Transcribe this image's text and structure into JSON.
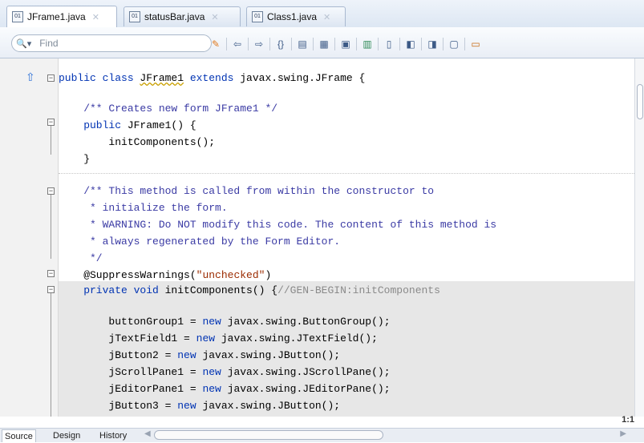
{
  "tabs": [
    {
      "label": "JFrame1.java",
      "active": true
    },
    {
      "label": "statusBar.java",
      "active": false
    },
    {
      "label": "Class1.java",
      "active": false
    }
  ],
  "toolbar": {
    "search_placeholder": "Find",
    "icons": [
      "search-icon",
      "source-history-icon",
      "back-icon",
      "forward-icon",
      "toggle-comment-icon",
      "braces-icon",
      "shift-left-icon",
      "shift-right-icon",
      "record-macro-icon",
      "bookmark-icon",
      "prev-bookmark-icon",
      "next-bookmark-icon",
      "toggle-highlight-icon",
      "diff-icon"
    ]
  },
  "code": {
    "l1_kw": "public class ",
    "l1_id": "JFrame1",
    "l1_kw2": " extends ",
    "l1_rest": "javax.swing.JFrame {",
    "l2_cm": "    /** Creates new form JFrame1 */",
    "l3_kw": "    public ",
    "l3_rest": "JFrame1() {",
    "l4": "        initComponents();",
    "l5": "    }",
    "l6_cm": "    /** This method is called from within the constructor to",
    "l7_cm": "     * initialize the form.",
    "l8_cm": "     * WARNING: Do NOT modify this code. The content of this method is",
    "l9_cm": "     * always regenerated by the Form Editor.",
    "l10_cm": "     */",
    "l11_ann": "    @SuppressWarnings(",
    "l11_str": "\"unchecked\"",
    "l11_end": ")",
    "l12_kw": "    private void ",
    "l12_id": "initComponents() {",
    "l12_cm": "//GEN-BEGIN:initComponents",
    "l13_a": "        buttonGroup1 = ",
    "l13_kw": "new ",
    "l13_b": "javax.swing.ButtonGroup();",
    "l14_a": "        jTextField1 = ",
    "l14_kw": "new ",
    "l14_b": "javax.swing.JTextField();",
    "l15_a": "        jButton2 = ",
    "l15_kw": "new ",
    "l15_b": "javax.swing.JButton();",
    "l16_a": "        jScrollPane1 = ",
    "l16_kw": "new ",
    "l16_b": "javax.swing.JScrollPane();",
    "l17_a": "        jEditorPane1 = ",
    "l17_kw": "new ",
    "l17_b": "javax.swing.JEditorPane();",
    "l18_a": "        jButton3 = ",
    "l18_kw": "new ",
    "l18_b": "javax.swing.JButton();"
  },
  "status": {
    "position": "1:1"
  },
  "bottom_tabs": {
    "source": "Source",
    "design": "Design",
    "history": "History"
  }
}
